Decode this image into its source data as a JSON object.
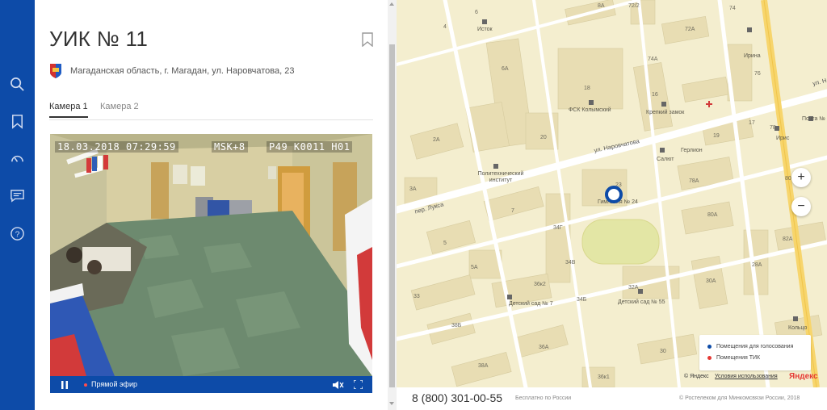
{
  "nav": {
    "icons": [
      "search-icon",
      "bookmark-icon",
      "gauge-icon",
      "chat-icon",
      "help-icon"
    ]
  },
  "panel": {
    "title": "УИК № 11",
    "address": "Магаданская область, г. Магадан, ул. Наровчатова, 23",
    "tabs": [
      {
        "label": "Камера 1",
        "active": true
      },
      {
        "label": "Камера 2",
        "active": false
      }
    ]
  },
  "video": {
    "timestamp": "18.03.2018 07:29:59",
    "timezone": "MSK+8",
    "camera_id": "P49 K0011 H01",
    "live_label": "Прямой эфир"
  },
  "map": {
    "streets": [
      "ул. Наровчатова",
      "пер. Лукса",
      "ул. Н"
    ],
    "buildings": [
      "8А",
      "72/2",
      "74",
      "72А",
      "4",
      "6",
      "74А",
      "76",
      "6А",
      "18",
      "16",
      "17",
      "78",
      "80",
      "2А",
      "20",
      "19",
      "78А",
      "3А",
      "7",
      "5",
      "34Г",
      "80А",
      "82А",
      "5А",
      "34В",
      "28А",
      "36к2",
      "33",
      "34Б",
      "32А",
      "30А",
      "38Б",
      "36А",
      "30",
      "38А",
      "36к1",
      "23"
    ],
    "pois": [
      "Исток",
      "Ирина",
      "ФСК Колымский",
      "Крепкий замок",
      "Почта №",
      "Политехнический институт",
      "Салют",
      "Герлион",
      "Ирис",
      "Гимназия № 24",
      "Детский сад № 7",
      "Детский сад № 55",
      "Кольцо"
    ],
    "zoom_in": "+",
    "zoom_out": "−",
    "legend": [
      {
        "label": "Помещения для голосования",
        "color": "#0d4ba8"
      },
      {
        "label": "Помещения ТИК",
        "color": "#e53935"
      }
    ],
    "copyright": "© Яндекс",
    "terms": "Условия использования",
    "logo": "Яндекс"
  },
  "footer": {
    "phone": "8 (800) 301-00-55",
    "free_note": "Бесплатно по России",
    "copyright": "© Ростелеком для Минкомсвязи России, 2018"
  },
  "colors": {
    "brand": "#0d4ba8",
    "map_bg": "#f4eecf",
    "road": "#ffffff",
    "highway": "#f7d56c",
    "building": "#e8ddb3",
    "park": "#e3e6a5"
  }
}
